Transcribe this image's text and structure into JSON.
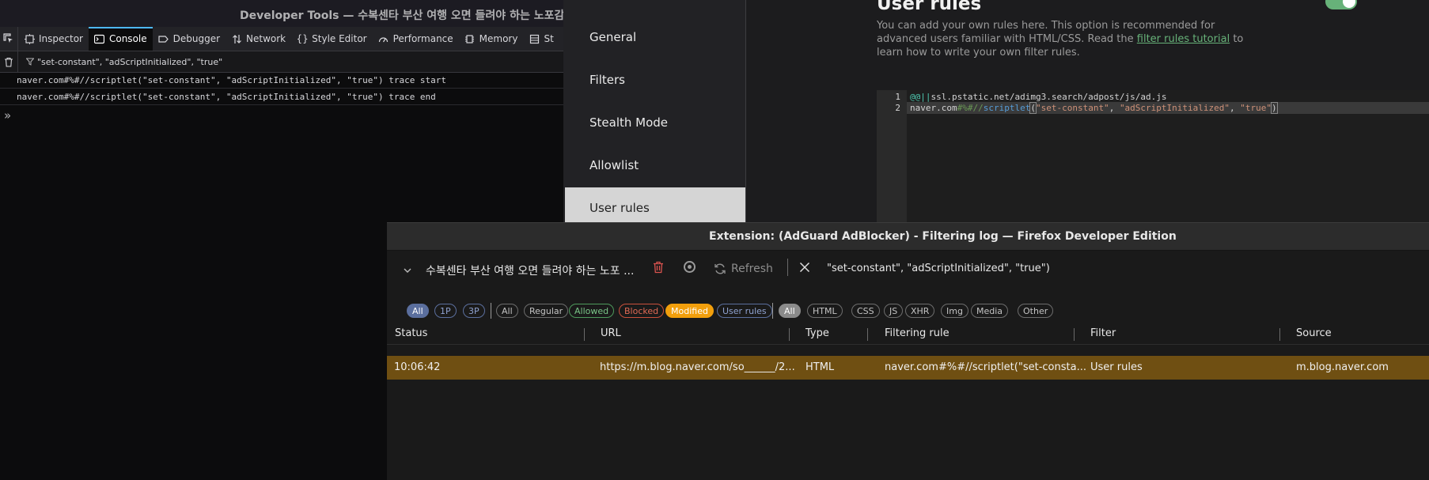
{
  "devtools": {
    "window_title": "Developer Tools — 수복센타 부산 여행 오면 들려야 하는 노포감성",
    "tabs": [
      {
        "label": "Inspector",
        "icon": "inspector-icon"
      },
      {
        "label": "Console",
        "icon": "console-icon",
        "active": true
      },
      {
        "label": "Debugger",
        "icon": "debugger-icon"
      },
      {
        "label": "Network",
        "icon": "network-icon"
      },
      {
        "label": "Style Editor",
        "icon": "style-editor-icon"
      },
      {
        "label": "Performance",
        "icon": "performance-icon"
      },
      {
        "label": "Memory",
        "icon": "memory-icon"
      },
      {
        "label": "St",
        "icon": "storage-icon"
      }
    ],
    "filter_text": "\"set-constant\", \"adScriptInitialized\", \"true\"",
    "logs": [
      "naver.com#%#//scriptlet(\"set-constant\", \"adScriptInitialized\", \"true\") trace start",
      "naver.com#%#//scriptlet(\"set-constant\", \"adScriptInitialized\", \"true\") trace end"
    ],
    "prompt": "»"
  },
  "settings": {
    "nav": [
      "General",
      "Filters",
      "Stealth Mode",
      "Allowlist",
      "User rules"
    ],
    "header": "User rules",
    "toggle_on": true,
    "desc_before": "You can add your own rules here. This option is recommended for advanced users familiar with HTML/CSS. Read the ",
    "desc_link": "filter rules tutorial",
    "desc_after": " to learn how to write your own filter rules.",
    "editor": {
      "line_numbers": [
        "1",
        "2"
      ],
      "line1": {
        "at": "@@||",
        "rest": "ssl.pstatic.net/adimg3.search/adpost/js/ad.js"
      },
      "line2": {
        "domain": "naver.com",
        "sep": "#%#//",
        "kw": "scriptlet",
        "open": "(",
        "a1": "\"set-constant\"",
        "comma1": ", ",
        "a2": "\"adScriptInitialized\"",
        "comma2": ", ",
        "a3": "\"true\"",
        "close": ")"
      }
    }
  },
  "filtering_log": {
    "window_title": "Extension: (AdGuard AdBlocker) - Filtering log — Firefox Developer Edition",
    "tab_selector": "수복센타 부산 여행 오면 들려야 하는 노포 ...",
    "refresh_label": "Refresh",
    "search_value": "\"set-constant\", \"adScriptInitialized\", \"true\")",
    "party_chips": [
      "All",
      "1P",
      "3P"
    ],
    "status_chips": [
      "All",
      "Regular",
      "Allowed",
      "Blocked",
      "Modified",
      "User rules"
    ],
    "type_chips": [
      "All",
      "HTML",
      "CSS",
      "JS",
      "XHR",
      "Img",
      "Media",
      "Other"
    ],
    "columns": [
      "Status",
      "URL",
      "Type",
      "Filtering rule",
      "Filter",
      "Source"
    ],
    "rows": [
      {
        "status": "10:06:42",
        "url": "https://m.blog.naver.com/so______/2...",
        "type": "HTML",
        "rule": "naver.com#%#//scriptlet(\"set-consta...",
        "filter": "User rules",
        "source": "m.blog.naver.com"
      }
    ],
    "colors": {
      "row_modified": "#6f4f12",
      "modified_chip": "#f29f0c",
      "accent_green": "#67b279"
    }
  }
}
